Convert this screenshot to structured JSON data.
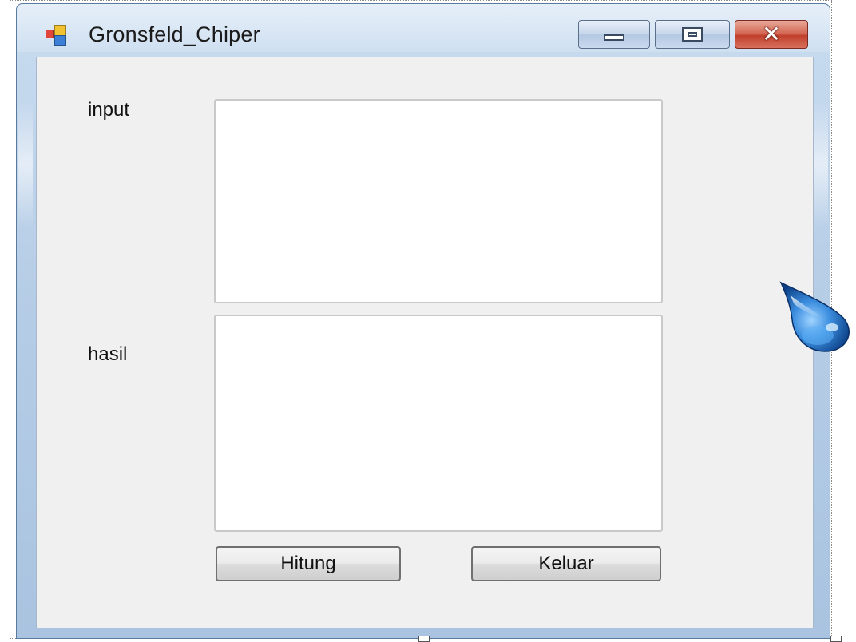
{
  "window": {
    "title": "Gronsfeld_Chiper",
    "icon": "windows-forms-app-icon",
    "controls": {
      "minimize_icon": "minimize-icon",
      "maximize_icon": "maximize-icon",
      "close_icon": "close-icon",
      "close_glyph": "✕"
    }
  },
  "form": {
    "input_label": "input",
    "result_label": "hasil",
    "input_value": "",
    "result_value": "",
    "calculate_button": "Hitung",
    "exit_button": "Keluar"
  },
  "overlay": {
    "icon": "water-drop-icon"
  },
  "colors": {
    "form_background": "#f0f0f0",
    "frame": "#b6cde6",
    "close_button": "#c0402c",
    "drop_blue": "#2f7fd0"
  }
}
